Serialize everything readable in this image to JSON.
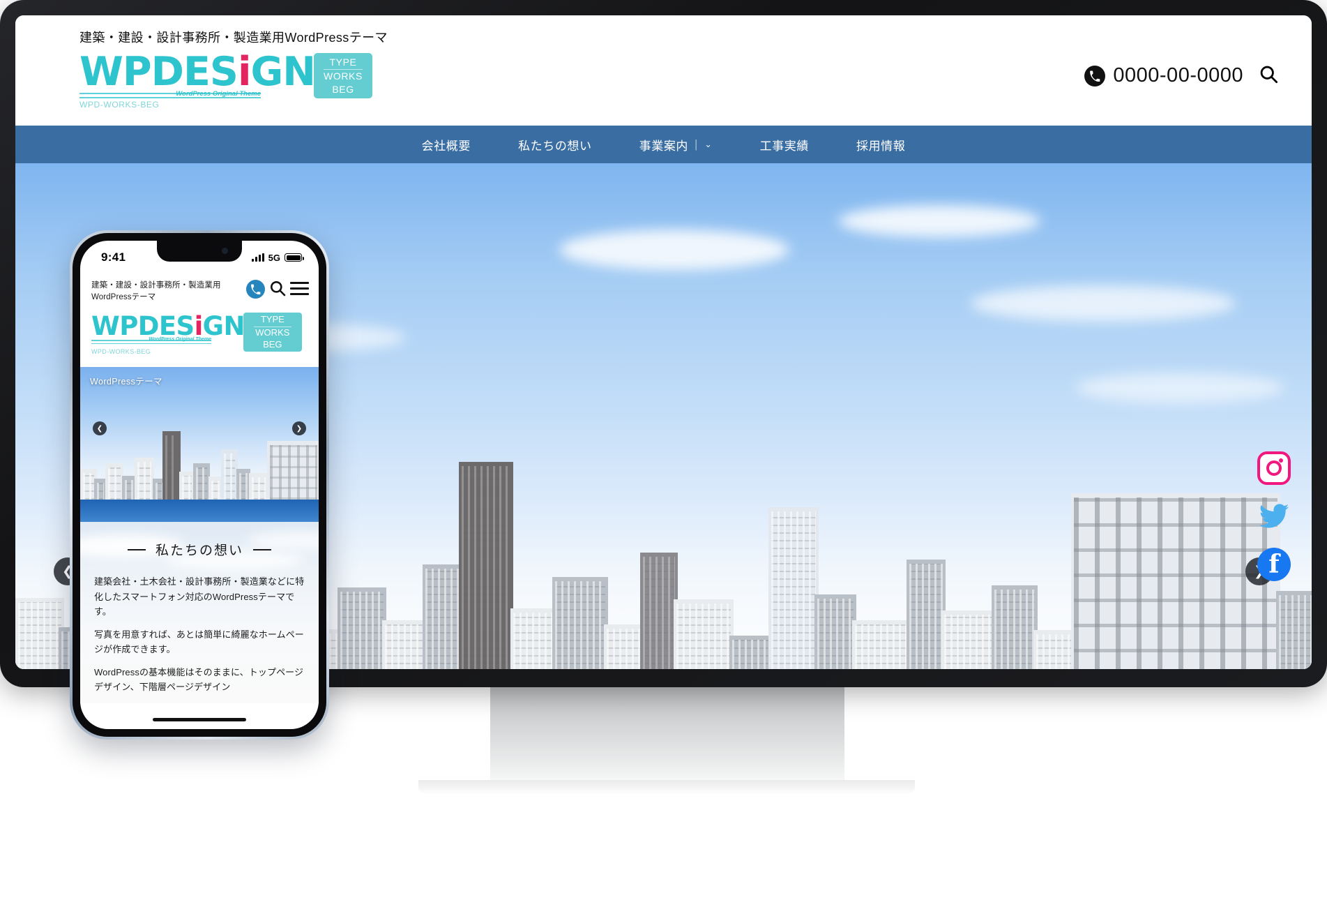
{
  "desktop": {
    "tagline": "建築・建設・設計事務所・製造業用WordPressテーマ",
    "logo": {
      "word_pre": "WPDES",
      "word_i": "i",
      "word_post": "GN",
      "sub_left": "WPD-WORKS-BEG",
      "sub_right": "WordPress Original Theme",
      "badge_line1": "TYPE",
      "badge_line2": "WORKS",
      "badge_line3": "BEG"
    },
    "header": {
      "phone_number": "0000-00-0000",
      "phone_icon": "phone-icon",
      "search_icon": "search-icon"
    },
    "nav": [
      {
        "label": "会社概要",
        "has_dropdown": false
      },
      {
        "label": "私たちの想い",
        "has_dropdown": false
      },
      {
        "label": "事業案内",
        "has_dropdown": true,
        "separator": "|",
        "caret": "⌄"
      },
      {
        "label": "工事実績",
        "has_dropdown": false
      },
      {
        "label": "採用情報",
        "has_dropdown": false
      }
    ],
    "hero": {
      "prev_arrow": "❮",
      "next_arrow": "❯",
      "alt": "city-skyline-hero-image"
    },
    "social": [
      {
        "name": "instagram",
        "color": "#f0177f"
      },
      {
        "name": "twitter",
        "color": "#4cb0ee"
      },
      {
        "name": "facebook",
        "color": "#1878f2",
        "glyph": "f"
      }
    ]
  },
  "mobile": {
    "status": {
      "time": "9:41",
      "network": "5G"
    },
    "header": {
      "tagline": "建築・建設・設計事務所・製造業用WordPressテーマ",
      "phone_icon": "phone-icon",
      "search_icon": "search-icon",
      "menu_icon": "hamburger-menu-icon"
    },
    "logo": {
      "word_pre": "WPDES",
      "word_i": "i",
      "word_post": "GN",
      "sub_left": "WPD-WORKS-BEG",
      "sub_right": "WordPress Original Theme",
      "badge_line1": "TYPE",
      "badge_line2": "WORKS",
      "badge_line3": "BEG"
    },
    "hero": {
      "label": "WordPressテーマ",
      "prev_arrow": "❮",
      "next_arrow": "❯"
    },
    "section": {
      "title": "私たちの想い",
      "paragraphs": [
        "建築会社・土木会社・設計事務所・製造業などに特化したスマートフォン対応のWordPressテーマです。",
        "写真を用意すれば、あとは簡単に綺麗なホームページが作成できます。",
        "WordPressの基本機能はそのままに、トップページデザイン、下階層ページデザイン"
      ]
    }
  },
  "colors": {
    "brand_teal": "#2ec4cd",
    "badge_teal": "#63cdd2",
    "nav_blue": "#3a6ea3",
    "accent_pink": "#e2245f",
    "mobile_band": "#2a6cbb"
  }
}
